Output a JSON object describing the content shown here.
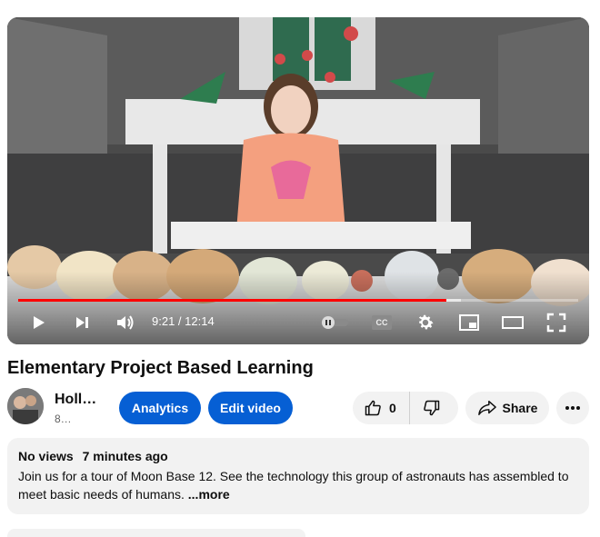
{
  "player": {
    "current_time": "9:21",
    "duration": "12:14",
    "time_display": "9:21 / 12:14",
    "progress_played": 0.765,
    "progress_buffered": 0.79,
    "accent_color": "#ff0000"
  },
  "controls": {
    "play_icon": "play-icon",
    "next_icon": "next-icon",
    "volume_icon": "volume-icon",
    "autoplay_icon": "autoplay-toggle-icon",
    "captions_icon": "captions-icon",
    "captions_label": "CC",
    "settings_icon": "gear-icon",
    "miniplayer_icon": "miniplayer-icon",
    "theater_icon": "theater-mode-icon",
    "fullscreen_icon": "fullscreen-icon"
  },
  "video": {
    "title": "Elementary Project Based Learning"
  },
  "channel": {
    "name": "Holly E",
    "subscribers": "8…"
  },
  "actions": {
    "analytics_label": "Analytics",
    "edit_video_label": "Edit video",
    "like_count": "0",
    "share_label": "Share",
    "brand_color": "#065fd4"
  },
  "description": {
    "views": "No views",
    "posted": "7 minutes ago",
    "text": "Join us for a tour of Moon Base 12. See the technology this group of astronauts has assembled to meet basic needs of humans.",
    "more_label": "...more"
  }
}
